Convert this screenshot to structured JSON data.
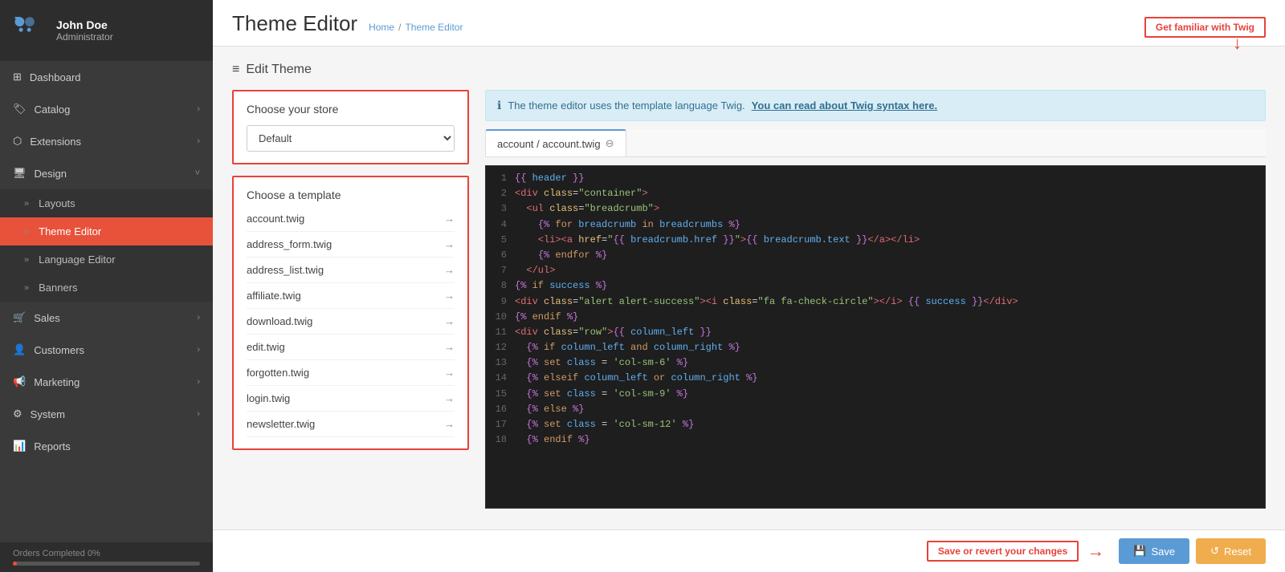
{
  "user": {
    "name": "John Doe",
    "role": "Administrator"
  },
  "sidebar": {
    "nav_items": [
      {
        "id": "dashboard",
        "label": "Dashboard",
        "icon": "⊞",
        "has_sub": false
      },
      {
        "id": "catalog",
        "label": "Catalog",
        "icon": "🏷",
        "has_sub": true
      },
      {
        "id": "extensions",
        "label": "Extensions",
        "icon": "🔌",
        "has_sub": true
      },
      {
        "id": "design",
        "label": "Design",
        "icon": "🖥",
        "has_sub": true,
        "active": true
      }
    ],
    "design_sub": [
      {
        "id": "layouts",
        "label": "Layouts"
      },
      {
        "id": "theme-editor",
        "label": "Theme Editor",
        "active": true
      },
      {
        "id": "language-editor",
        "label": "Language Editor"
      },
      {
        "id": "banners",
        "label": "Banners"
      }
    ],
    "nav_items2": [
      {
        "id": "sales",
        "label": "Sales",
        "icon": "🛒",
        "has_sub": true
      },
      {
        "id": "customers",
        "label": "Customers",
        "icon": "👤",
        "has_sub": true
      },
      {
        "id": "marketing",
        "label": "Marketing",
        "icon": "📢",
        "has_sub": true
      },
      {
        "id": "system",
        "label": "System",
        "icon": "⚙",
        "has_sub": true
      },
      {
        "id": "reports",
        "label": "Reports",
        "icon": "📊",
        "has_sub": false
      }
    ],
    "footer": {
      "label": "Orders Completed",
      "value": "0%"
    }
  },
  "header": {
    "title": "Theme Editor",
    "breadcrumb_home": "Home",
    "breadcrumb_current": "Theme Editor"
  },
  "callout_twig": "Get familiar with Twig",
  "callout_save": "Save or revert your changes",
  "left_panel": {
    "store_box_title": "Choose your store",
    "store_options": [
      "Default"
    ],
    "store_selected": "Default",
    "template_box_title": "Choose a template",
    "templates": [
      {
        "name": "account.twig"
      },
      {
        "name": "address_form.twig"
      },
      {
        "name": "address_list.twig"
      },
      {
        "name": "affiliate.twig"
      },
      {
        "name": "download.twig"
      },
      {
        "name": "edit.twig"
      },
      {
        "name": "forgotten.twig"
      },
      {
        "name": "login.twig"
      },
      {
        "name": "newsletter.twig"
      }
    ]
  },
  "right_panel": {
    "info_text": "The theme editor uses the template language Twig.",
    "info_link": "You can read about Twig syntax here.",
    "tab_label": "account / account.twig",
    "code_lines": [
      {
        "num": 1,
        "code": "{{ header }}"
      },
      {
        "num": 2,
        "code": "<div class=\"container\">"
      },
      {
        "num": 3,
        "code": "  <ul class=\"breadcrumb\">"
      },
      {
        "num": 4,
        "code": "    {% for breadcrumb in breadcrumbs %}"
      },
      {
        "num": 5,
        "code": "    <li><a href=\"{{ breadcrumb.href }}\">{{ breadcrumb.text }}</a></li>"
      },
      {
        "num": 6,
        "code": "    {% endfor %}"
      },
      {
        "num": 7,
        "code": "  </ul>"
      },
      {
        "num": 8,
        "code": "{% if success %}"
      },
      {
        "num": 9,
        "code": "<div class=\"alert alert-success\"><i class=\"fa fa-check-circle\"></i> {{ success }}</div>"
      },
      {
        "num": 10,
        "code": "{% endif %}"
      },
      {
        "num": 11,
        "code": "<div class=\"row\">{{ column_left }}"
      },
      {
        "num": 12,
        "code": "  {% if column_left and column_right %}"
      },
      {
        "num": 13,
        "code": "  {% set class = 'col-sm-6' %}"
      },
      {
        "num": 14,
        "code": "  {% elseif column_left or column_right %}"
      },
      {
        "num": 15,
        "code": "  {% set class = 'col-sm-9' %}"
      },
      {
        "num": 16,
        "code": "  {% else %}"
      },
      {
        "num": 17,
        "code": "  {% set class = 'col-sm-12' %}"
      },
      {
        "num": 18,
        "code": "  {% endif %}"
      }
    ]
  },
  "buttons": {
    "save_label": "Save",
    "reset_label": "Reset"
  }
}
